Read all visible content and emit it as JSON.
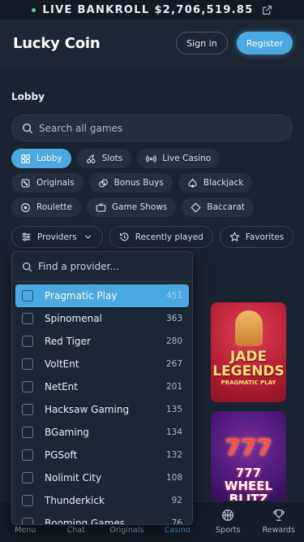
{
  "topbar": {
    "label": "LIVE BANKROLL",
    "amount": "$2,706,519.85"
  },
  "header": {
    "logo": "Lucky Coin",
    "signin": "Sign in",
    "register": "Register"
  },
  "lobby": {
    "title": "Lobby"
  },
  "search": {
    "placeholder": "Search all games"
  },
  "categories": {
    "row1": [
      "Lobby",
      "Slots",
      "Live Casino"
    ],
    "row2": [
      "Originals",
      "Bonus Buys",
      "Blackjack"
    ],
    "row3": [
      "Roulette",
      "Game Shows",
      "Baccarat"
    ]
  },
  "filters": {
    "providers": "Providers",
    "recent": "Recently played",
    "favorites": "Favorites"
  },
  "provider_dropdown": {
    "search_placeholder": "Find a provider...",
    "items": [
      {
        "name": "Pragmatic Play",
        "count": "451"
      },
      {
        "name": "Spinomenal",
        "count": "363"
      },
      {
        "name": "Red Tiger",
        "count": "280"
      },
      {
        "name": "VoltEnt",
        "count": "267"
      },
      {
        "name": "NetEnt",
        "count": "201"
      },
      {
        "name": "Hacksaw Gaming",
        "count": "135"
      },
      {
        "name": "BGaming",
        "count": "134"
      },
      {
        "name": "PGSoft",
        "count": "132"
      },
      {
        "name": "Nolimit City",
        "count": "108"
      },
      {
        "name": "Thunderkick",
        "count": "92"
      },
      {
        "name": "Booming Games",
        "count": "76"
      }
    ]
  },
  "games": [
    {
      "title_line1": "JADE",
      "title_line2": "LEGENDS",
      "provider": "PRAGMATIC PLAY"
    },
    {
      "art": "777",
      "title_line1": "777 WHEEL",
      "title_line2": "BLITZ"
    }
  ],
  "bottom_nav": {
    "menu": "Menu",
    "chat": "Chat",
    "originals": "Originals",
    "casino": "Casino",
    "sports": "Sports",
    "rewards": "Rewards"
  },
  "colors": {
    "accent": "#4ba8e0",
    "live_dot": "#3fdc8a",
    "background": "#1a2330"
  }
}
